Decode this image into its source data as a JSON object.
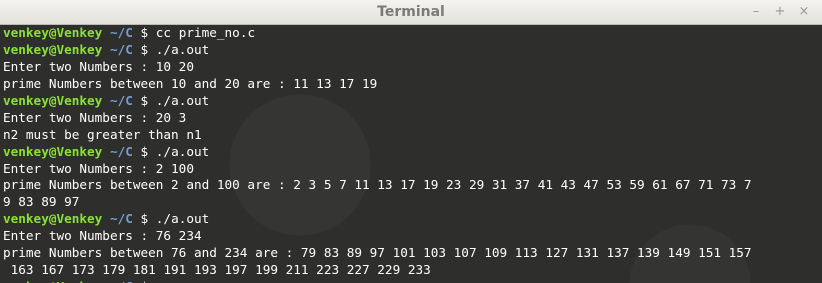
{
  "window": {
    "title": "Terminal"
  },
  "controls": {
    "minimize": "–",
    "maximize": "+",
    "close": "×"
  },
  "terminal": {
    "prompt_user": "venkey@Venkey",
    "prompt_path": "~/C",
    "prompt_symbol": "$",
    "lines": [
      {
        "type": "cmd",
        "cmd": "cc prime_no.c"
      },
      {
        "type": "cmd",
        "cmd": "./a.out"
      },
      {
        "type": "out",
        "text": "Enter two Numbers : 10 20"
      },
      {
        "type": "out",
        "text": "prime Numbers between 10 and 20 are : 11 13 17 19"
      },
      {
        "type": "cmd",
        "cmd": "./a.out"
      },
      {
        "type": "out",
        "text": "Enter two Numbers : 20 3"
      },
      {
        "type": "out",
        "text": "n2 must be greater than n1"
      },
      {
        "type": "cmd",
        "cmd": "./a.out"
      },
      {
        "type": "out",
        "text": "Enter two Numbers : 2 100"
      },
      {
        "type": "out",
        "text": "prime Numbers between 2 and 100 are : 2 3 5 7 11 13 17 19 23 29 31 37 41 43 47 53 59 61 67 71 73 7"
      },
      {
        "type": "out",
        "text": "9 83 89 97"
      },
      {
        "type": "cmd",
        "cmd": "./a.out"
      },
      {
        "type": "out",
        "text": "Enter two Numbers : 76 234"
      },
      {
        "type": "out",
        "text": "prime Numbers between 76 and 234 are : 79 83 89 97 101 103 107 109 113 127 131 137 139 149 151 157"
      },
      {
        "type": "out",
        "text": " 163 167 173 179 181 191 193 197 199 211 223 227 229 233"
      },
      {
        "type": "cmd",
        "cmd": ""
      }
    ]
  },
  "colors": {
    "user": "#8ae234",
    "path": "#729fcf",
    "background": "#2e2e2c",
    "text": "#ffffff"
  }
}
